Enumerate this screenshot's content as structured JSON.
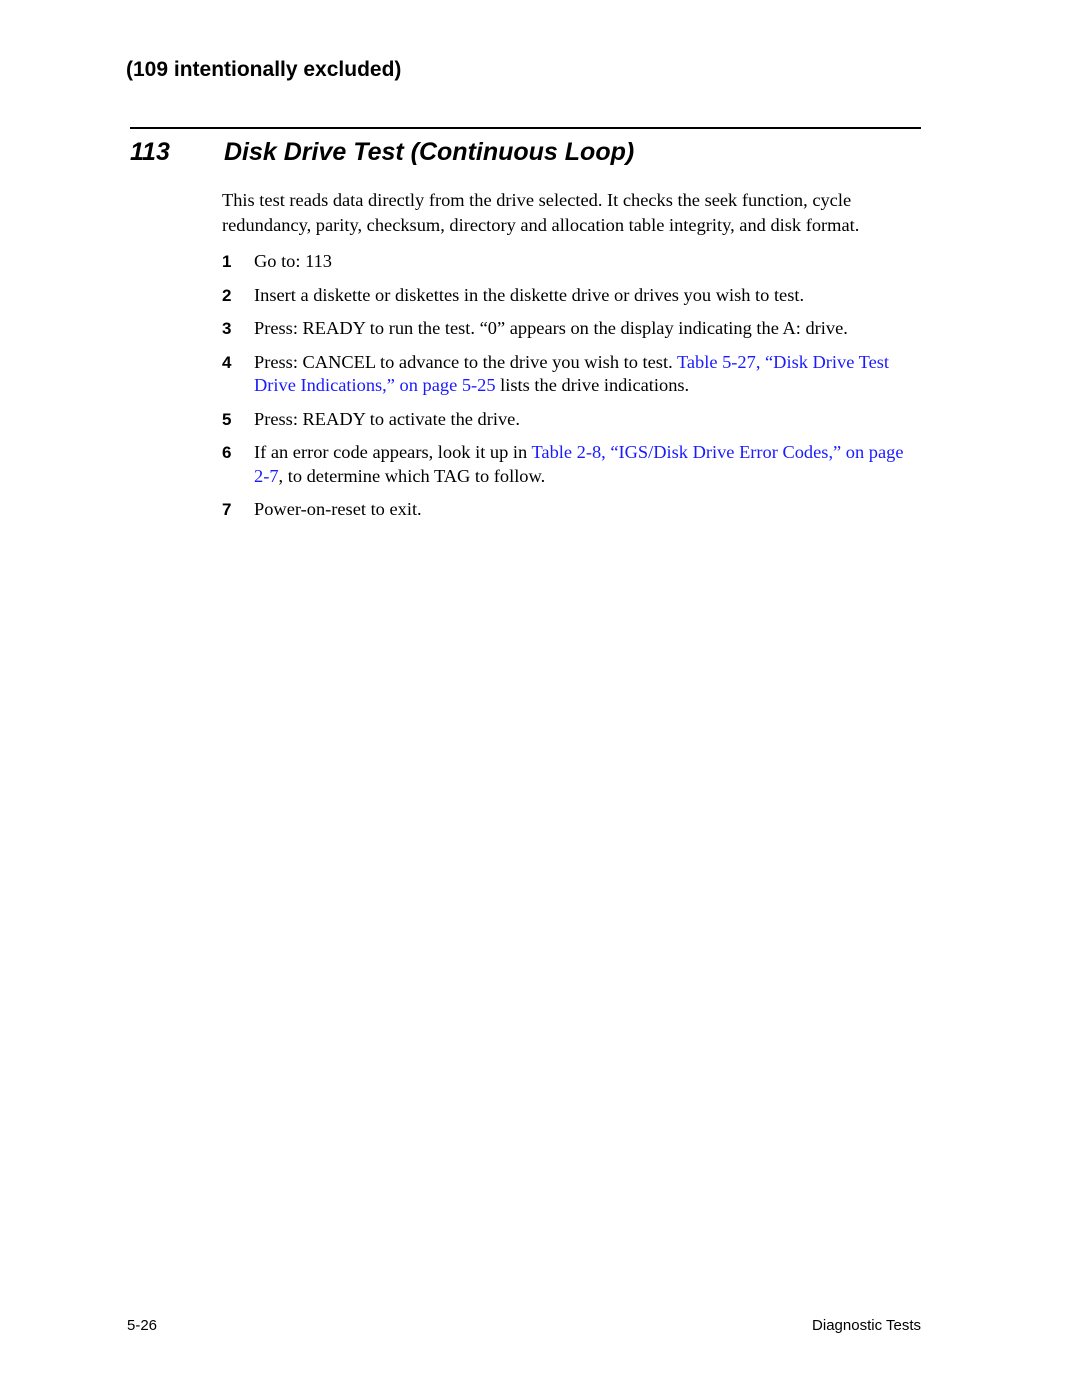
{
  "excluded_note": "(109 intentionally excluded)",
  "section": {
    "number": "113",
    "title": "Disk Drive Test (Continuous Loop)"
  },
  "intro": "This test reads data directly from the drive selected. It checks the seek function, cycle redundancy, parity, checksum, directory and allocation table integrity, and disk format.",
  "colors": {
    "link": "#1a1aff",
    "text": "#000000"
  },
  "steps": [
    {
      "num": "1",
      "text": "Go to: 113"
    },
    {
      "num": "2",
      "text": "Insert a diskette or diskettes in the diskette drive or drives you wish to test."
    },
    {
      "num": "3",
      "text": "Press: READY to run the test. “0” appears on the display indicating the A: drive."
    },
    {
      "num": "4",
      "pre": "Press: CANCEL to advance to the drive you wish to test. ",
      "link": "Table 5-27, “Disk Drive Test Drive Indications,” on page 5-25",
      "post": " lists the drive indications."
    },
    {
      "num": "5",
      "text": "Press: READY to activate the drive."
    },
    {
      "num": "6",
      "pre": "If an error code appears, look it up in ",
      "link1": "Table 2-8, “IGS/Disk Drive Error Codes,” on page ",
      "link2": "2-7",
      "post": ", to determine which TAG to follow."
    },
    {
      "num": "7",
      "text": "Power-on-reset to exit."
    }
  ],
  "footer": {
    "page_number": "5-26",
    "chapter": "Diagnostic Tests"
  }
}
